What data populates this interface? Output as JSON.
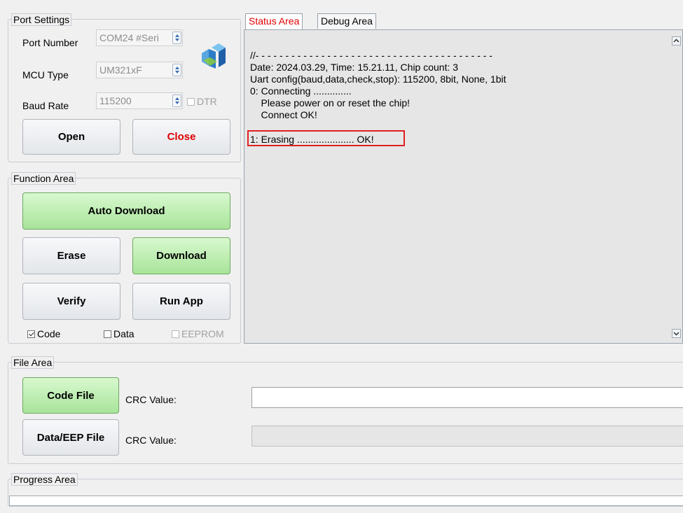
{
  "port_settings": {
    "title": "Port Settings",
    "port_number_label": "Port Number",
    "port_number_value": "COM24 #Seri",
    "mcu_type_label": "MCU Type",
    "mcu_type_value": "UM321xF",
    "baud_rate_label": "Baud Rate",
    "baud_rate_value": "115200",
    "dtr_label": "DTR",
    "open_label": "Open",
    "close_label": "Close"
  },
  "function_area": {
    "title": "Function Area",
    "auto_download_label": "Auto Download",
    "erase_label": "Erase",
    "download_label": "Download",
    "verify_label": "Verify",
    "run_app_label": "Run App",
    "code_check_label": "Code",
    "data_check_label": "Data",
    "eeprom_check_label": "EEPROM"
  },
  "tabs": {
    "status_label": "Status Area",
    "debug_label": "Debug Area"
  },
  "status_log": {
    "lines": [
      "//- - - - - - - - - - - - - - - - - - - - - - - - - - - - - - - - - - - - - - - -",
      "Date: 2024.03.29, Time: 15.21.11, Chip count: 3",
      "Uart config(baud,data,check,stop): 115200, 8bit, None, 1bit",
      "0: Connecting ..............",
      "    Please power on or reset the chip!",
      "    Connect OK!",
      "1: Erasing ..................... OK!"
    ]
  },
  "file_area": {
    "title": "File Area",
    "code_file_label": "Code File",
    "data_eep_file_label": "Data/EEP File",
    "crc_label_1": "CRC Value:",
    "crc_label_2": "CRC Value:"
  },
  "progress_area": {
    "title": "Progress Area"
  },
  "colors": {
    "active_tab_text": "#e00000",
    "highlight_box": "#e02020",
    "green_button": "#a8e49a"
  }
}
